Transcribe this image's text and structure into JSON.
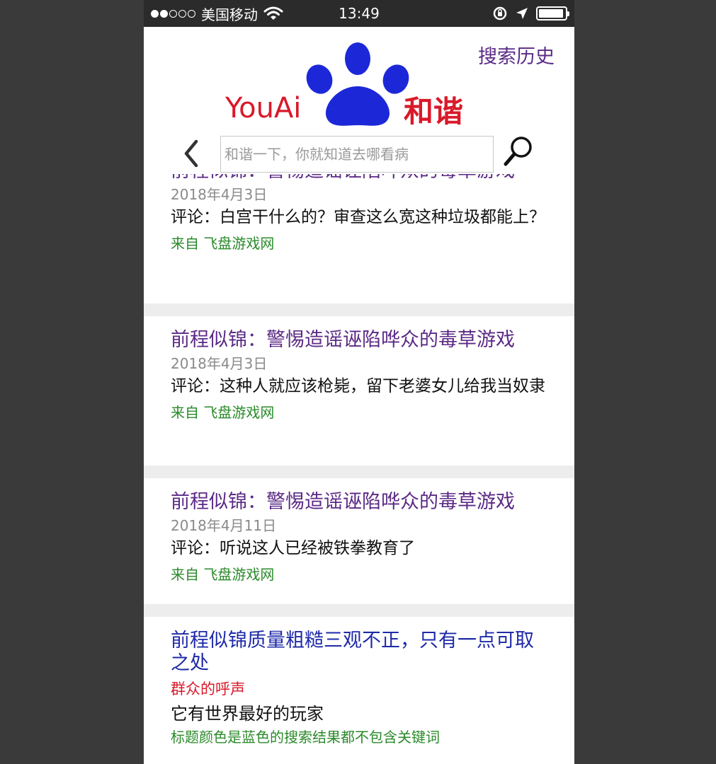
{
  "status_bar": {
    "carrier": "美国移动",
    "time": "13:49",
    "signal_dots": [
      "filled",
      "filled",
      "empty",
      "empty",
      "empty"
    ],
    "battery_fraction": 0.95
  },
  "header": {
    "history_label": "搜索历史",
    "logo_left": "YouAi",
    "logo_right": "和谐",
    "search_placeholder": "和谐一下，你就知道去哪看病"
  },
  "colors": {
    "purple_title": "#5b2a86",
    "blue_title": "#1f2aa8",
    "source_green": "#2a8a2a",
    "logo_red": "#d9192a",
    "paw_blue": "#1c28d8"
  },
  "results": [
    {
      "title": "前程似锦：警惕造谣诬陷哗众的毒草游戏",
      "date": "2018年4月3日",
      "comment": "评论：白宫干什么的？审查这么宽这种垃圾都能上？",
      "source": "来自 飞盘游戏网"
    },
    {
      "title": "前程似锦：警惕造谣诬陷哗众的毒草游戏",
      "date": "2018年4月3日",
      "comment": "评论：这种人就应该枪毙，留下老婆女儿给我当奴隶",
      "source": "来自 飞盘游戏网"
    },
    {
      "title": "前程似锦：警惕造谣诬陷哗众的毒草游戏",
      "date": "2018年4月11日",
      "comment": "评论：听说这人已经被铁拳教育了",
      "source": "来自 飞盘游戏网"
    }
  ],
  "featured": {
    "title": "前程似锦质量粗糙三观不正，只有一点可取之处",
    "red_label": "群众的呼声",
    "text": "它有世界最好的玩家",
    "note": "标题颜色是蓝色的搜索结果都不包含关键词"
  }
}
